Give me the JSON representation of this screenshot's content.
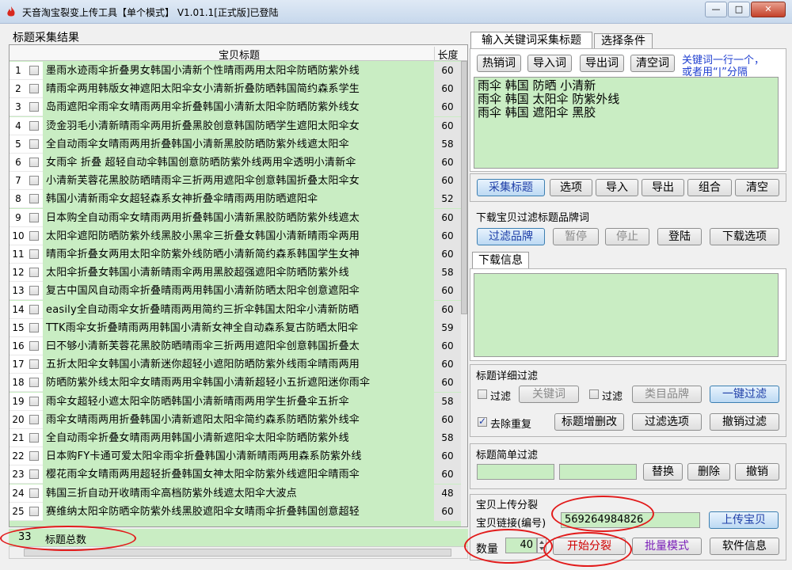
{
  "window": {
    "title": "天音淘宝裂变上传工具【单个模式】 V1.01.1[正式版]已登陆",
    "min": "—",
    "max": "□",
    "close": "✕"
  },
  "left": {
    "section_label": "标题采集结果",
    "columns": {
      "title": "宝贝标题",
      "length": "长度"
    },
    "rows": [
      {
        "num": "1",
        "title": "墨雨水迹雨伞折叠男女韩国小清新个性晴雨两用太阳伞防晒防紫外线",
        "len": "60"
      },
      {
        "num": "2",
        "title": "晴雨伞两用韩版女神遮阳太阳伞女小清新折叠防晒韩国简约森系学生",
        "len": "60"
      },
      {
        "num": "3",
        "title": "岛雨遮阳伞雨伞女晴雨两用伞折叠韩国小清新太阳伞防晒防紫外线女",
        "len": "60"
      },
      {
        "num": "4",
        "title": "烫金羽毛小清新晴雨伞两用折叠黑胶创意韩国防晒学生遮阳太阳伞女",
        "len": "60"
      },
      {
        "num": "5",
        "title": "全自动雨伞女晴雨两用折叠韩国小清新黑胶防晒防紫外线遮太阳伞",
        "len": "58"
      },
      {
        "num": "6",
        "title": "女雨伞 折叠 超轻自动伞韩国创意防晒防紫外线两用伞透明小清新伞",
        "len": "60"
      },
      {
        "num": "7",
        "title": "小清新芙蓉花黑胶防晒晴雨伞三折两用遮阳伞创意韩国折叠太阳伞女",
        "len": "60"
      },
      {
        "num": "8",
        "title": "韩国小清新雨伞女超轻森系女神折叠伞晴雨两用防晒遮阳伞",
        "len": "52"
      },
      {
        "num": "9",
        "title": "日本购全自动雨伞女晴雨两用折叠韩国小清新黑胶防晒防紫外线遮太",
        "len": "60"
      },
      {
        "num": "10",
        "title": "太阳伞遮阳防晒防紫外线黑胶小黑伞三折叠女韩国小清新晴雨伞两用",
        "len": "60"
      },
      {
        "num": "11",
        "title": "晴雨伞折叠女两用太阳伞防紫外线防晒小清新简约森系韩国学生女神",
        "len": "60"
      },
      {
        "num": "12",
        "title": "太阳伞折叠女韩国小清新晴雨伞两用黑胶超强遮阳伞防晒防紫外线",
        "len": "58"
      },
      {
        "num": "13",
        "title": "复古中国风自动雨伞折叠晴雨两用韩国小清新防晒太阳伞创意遮阳伞",
        "len": "60"
      },
      {
        "num": "14",
        "title": "easily全自动雨伞女折叠晴雨两用简约三折伞韩国太阳伞小清新防晒",
        "len": "60"
      },
      {
        "num": "15",
        "title": "TTK雨伞女折叠晴雨两用韩国小清新女神全自动森系复古防晒太阳伞",
        "len": "59"
      },
      {
        "num": "16",
        "title": "曰不够小清新芙蓉花黑胶防晒晴雨伞三折两用遮阳伞创意韩国折叠太",
        "len": "60"
      },
      {
        "num": "17",
        "title": "五折太阳伞女韩国小清新迷你超轻小遮阳防晒防紫外线雨伞晴雨两用",
        "len": "60"
      },
      {
        "num": "18",
        "title": "防晒防紫外线太阳伞女晴雨两用伞韩国小清新超轻小五折遮阳迷你雨伞",
        "len": "60"
      },
      {
        "num": "19",
        "title": "雨伞女超轻小遮太阳伞防晒韩国小清新晴雨两用学生折叠伞五折伞",
        "len": "58"
      },
      {
        "num": "20",
        "title": "雨伞女晴雨两用折叠韩国小清新遮阳太阳伞简约森系防晒防紫外线伞",
        "len": "60"
      },
      {
        "num": "21",
        "title": "全自动雨伞折叠女晴雨两用韩国小清新遮阳伞太阳伞防晒防紫外线",
        "len": "58"
      },
      {
        "num": "22",
        "title": "日本购FY卡通可爱太阳伞雨伞折叠韩国小清新晴雨两用森系防紫外线",
        "len": "60"
      },
      {
        "num": "23",
        "title": "樱花雨伞女晴雨两用超轻折叠韩国女神太阳伞防紫外线遮阳伞晴雨伞",
        "len": "60"
      },
      {
        "num": "24",
        "title": "韩国三折自动开收晴雨伞高档防紫外线遮太阳伞大波点",
        "len": "48"
      },
      {
        "num": "25",
        "title": "赛维纳太阳伞防晒伞防紫外线黑胶遮阳伞女晴雨伞折叠韩国创意超轻",
        "len": "60"
      }
    ],
    "total_count": "33",
    "total_label": "标题总数"
  },
  "right": {
    "tabs": {
      "keyword_collect": "输入关键词采集标题",
      "select_cond": "选择条件"
    },
    "kw_buttons": {
      "hot": "热销词",
      "import": "导入词",
      "export": "导出词",
      "clear": "清空词"
    },
    "kw_hint": {
      "line1": "关键词一行一个，",
      "line2": "或者用“|”分隔"
    },
    "keywords": [
      "雨伞 韩国 防晒 小清新",
      "雨伞 韩国 太阳伞 防紫外线",
      "雨伞 韩国 遮阳伞 黑胶"
    ],
    "collect_buttons": {
      "collect": "采集标题",
      "options": "选项",
      "import": "导入",
      "export": "导出",
      "combine": "组合",
      "clear": "清空"
    },
    "filter_brand_label": "下载宝贝过滤标题品牌词",
    "brand_buttons": {
      "filter": "过滤品牌",
      "pause": "暂停",
      "stop": "停止",
      "login": "登陆",
      "dl_options": "下载选项"
    },
    "download_tab": "下载信息",
    "detail_filter": {
      "label": "标题详细过滤",
      "filter1": "过滤",
      "keyword_btn": "关键词",
      "filter2": "过滤",
      "category_btn": "类目品牌",
      "one_click": "一键过滤",
      "dedupe": "去除重复",
      "edit_btn": "标题增删改",
      "filter_opts": "过滤选项",
      "undo": "撤销过滤"
    },
    "simple_filter": {
      "label": "标题简单过滤",
      "replace": "替换",
      "delete": "删除",
      "undo": "撤销"
    },
    "upload": {
      "label": "宝贝上传分裂",
      "link_label": "宝贝链接(编号)",
      "link_value": "569264984826",
      "upload_btn": "上传宝贝",
      "qty_label": "数量",
      "qty_value": "40",
      "start_btn": "开始分裂",
      "batch_btn": "批量模式",
      "info_btn": "软件信息"
    }
  }
}
